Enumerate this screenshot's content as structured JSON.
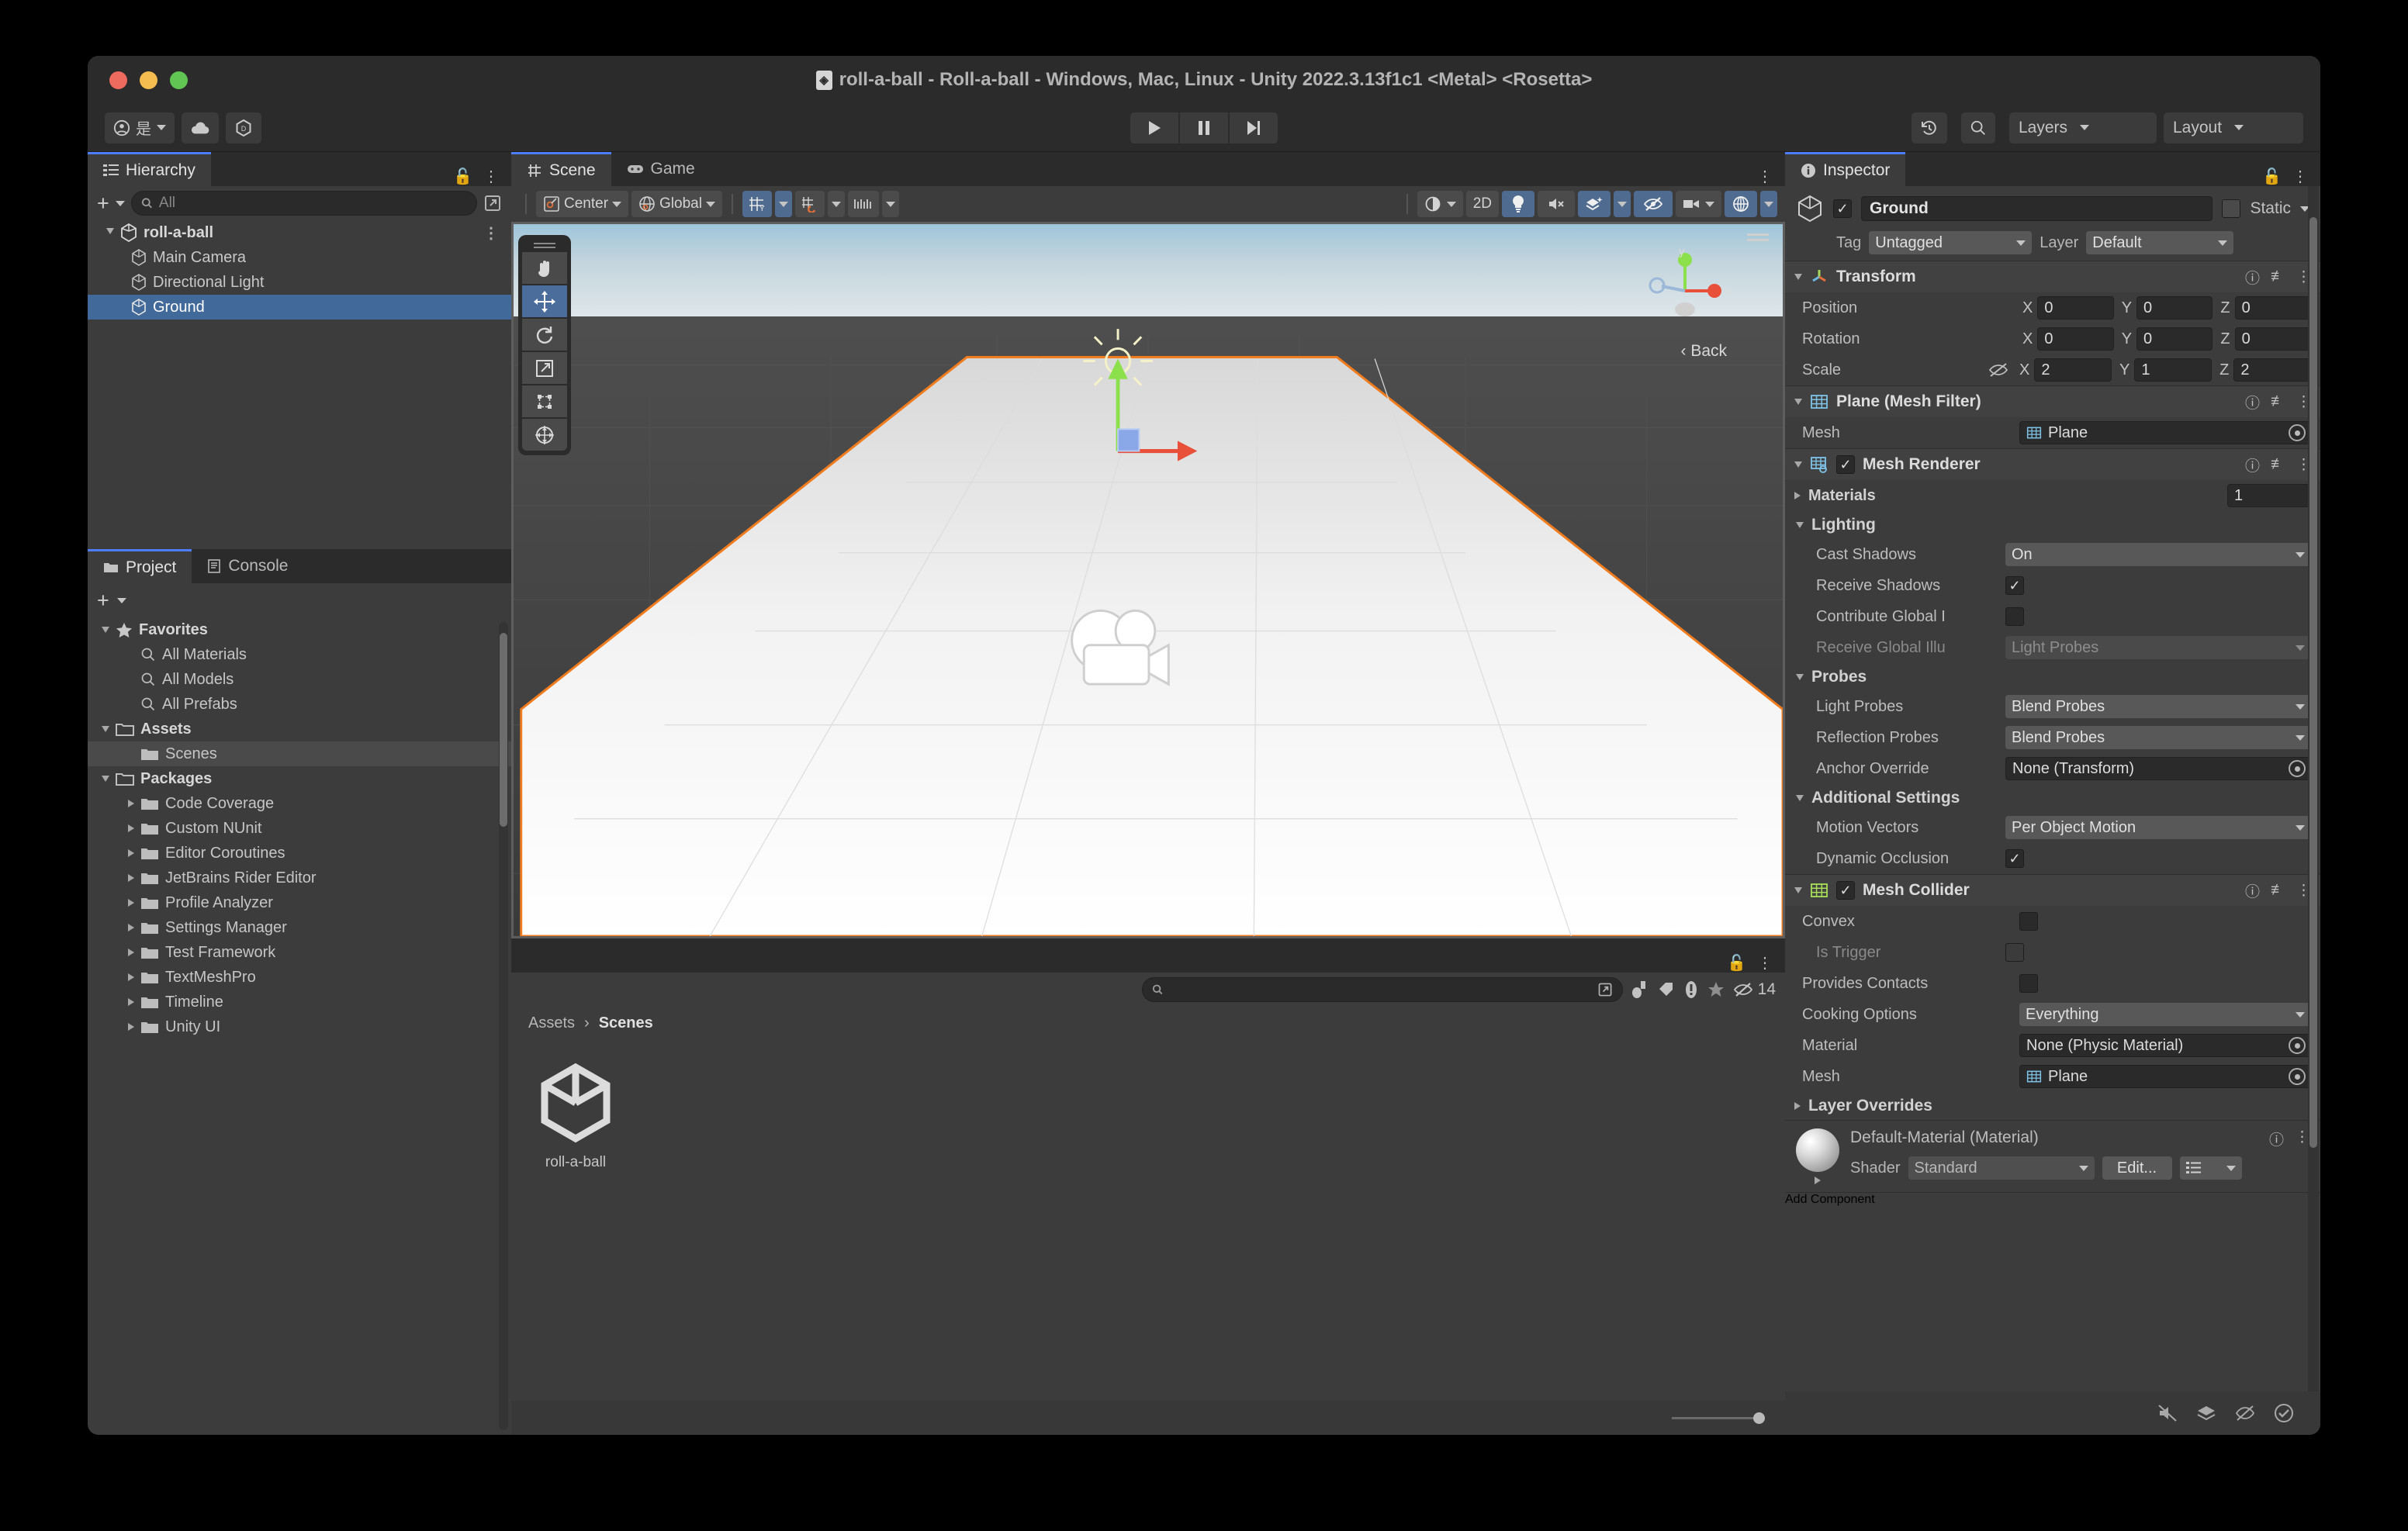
{
  "window": {
    "title": "roll-a-ball - Roll-a-ball - Windows, Mac, Linux - Unity 2022.3.13f1c1 <Metal> <Rosetta>"
  },
  "toolbar": {
    "account_label": "是",
    "cloud_icon": "cloud-icon",
    "services_icon": "unity-services-icon",
    "play_icon": "play-icon",
    "pause_icon": "pause-icon",
    "step_icon": "step-icon",
    "undo_history_icon": "undo-history-icon",
    "search_icon": "search-icon",
    "layers_label": "Layers",
    "layout_label": "Layout"
  },
  "hierarchy": {
    "tab_label": "Hierarchy",
    "search_placeholder": "All",
    "items": [
      {
        "label": "roll-a-ball",
        "depth": 0,
        "selected": false,
        "expanded": true
      },
      {
        "label": "Main Camera",
        "depth": 1,
        "selected": false
      },
      {
        "label": "Directional Light",
        "depth": 1,
        "selected": false
      },
      {
        "label": "Ground",
        "depth": 1,
        "selected": true
      }
    ]
  },
  "scene": {
    "tab_scene": "Scene",
    "tab_game": "Game",
    "pivot_mode": "Center",
    "pivot_rotation": "Global",
    "shading_mode": "shaded-icon",
    "view_2d": "2D",
    "lighting_icon": "lighting-icon",
    "audio_icon": "audio-mute-icon",
    "effects_icon": "effects-icon",
    "hidden_icon": "hidden-objects-icon",
    "camera_icon": "scene-camera-icon",
    "gizmos_icon": "gizmos-icon",
    "grid_icon": "grid-axis-icon",
    "snap_icon": "snap-increment-icon",
    "ruler_icon": "grid-size-icon",
    "orientation_back_label": "Back",
    "gizmo_axis_x": "x",
    "gizmo_axis_y": "y",
    "tools": [
      {
        "name": "hand-tool",
        "active": false
      },
      {
        "name": "move-tool",
        "active": true
      },
      {
        "name": "rotate-tool",
        "active": false
      },
      {
        "name": "scale-tool",
        "active": false
      },
      {
        "name": "rect-tool",
        "active": false
      },
      {
        "name": "transform-tool",
        "active": false
      }
    ]
  },
  "project": {
    "tab_project": "Project",
    "tab_console": "Console",
    "search_placeholder": "",
    "filter_count": "14",
    "breadcrumb": [
      "Assets",
      "Scenes"
    ],
    "tree": [
      {
        "label": "Favorites",
        "depth": 0,
        "icon": "star-icon",
        "expanded": true,
        "bold": true
      },
      {
        "label": "All Materials",
        "depth": 1,
        "icon": "search-icon"
      },
      {
        "label": "All Models",
        "depth": 1,
        "icon": "search-icon"
      },
      {
        "label": "All Prefabs",
        "depth": 1,
        "icon": "search-icon"
      },
      {
        "label": "Assets",
        "depth": 0,
        "icon": "folder-open-icon",
        "expanded": true,
        "bold": true
      },
      {
        "label": "Scenes",
        "depth": 1,
        "icon": "folder-icon",
        "selected": true
      },
      {
        "label": "Packages",
        "depth": 0,
        "icon": "folder-open-icon",
        "expanded": true,
        "bold": true
      },
      {
        "label": "Code Coverage",
        "depth": 1,
        "icon": "folder-icon",
        "collapsed": true
      },
      {
        "label": "Custom NUnit",
        "depth": 1,
        "icon": "folder-icon",
        "collapsed": true
      },
      {
        "label": "Editor Coroutines",
        "depth": 1,
        "icon": "folder-icon",
        "collapsed": true
      },
      {
        "label": "JetBrains Rider Editor",
        "depth": 1,
        "icon": "folder-icon",
        "collapsed": true
      },
      {
        "label": "Profile Analyzer",
        "depth": 1,
        "icon": "folder-icon",
        "collapsed": true
      },
      {
        "label": "Settings Manager",
        "depth": 1,
        "icon": "folder-icon",
        "collapsed": true
      },
      {
        "label": "Test Framework",
        "depth": 1,
        "icon": "folder-icon",
        "collapsed": true
      },
      {
        "label": "TextMeshPro",
        "depth": 1,
        "icon": "folder-icon",
        "collapsed": true
      },
      {
        "label": "Timeline",
        "depth": 1,
        "icon": "folder-icon",
        "collapsed": true
      },
      {
        "label": "Unity UI",
        "depth": 1,
        "icon": "folder-icon",
        "collapsed": true
      }
    ],
    "assets": [
      {
        "label": "roll-a-ball",
        "icon": "unity-scene-icon"
      }
    ]
  },
  "inspector": {
    "tab_label": "Inspector",
    "object_name": "Ground",
    "object_enabled": true,
    "static_label": "Static",
    "tag_label": "Tag",
    "tag_value": "Untagged",
    "layer_label": "Layer",
    "layer_value": "Default",
    "transform": {
      "title": "Transform",
      "position_label": "Position",
      "rotation_label": "Rotation",
      "scale_label": "Scale",
      "position": {
        "x": "0",
        "y": "0",
        "z": "0"
      },
      "rotation": {
        "x": "0",
        "y": "0",
        "z": "0"
      },
      "scale": {
        "x": "2",
        "y": "1",
        "z": "2"
      }
    },
    "mesh_filter": {
      "title": "Plane (Mesh Filter)",
      "mesh_label": "Mesh",
      "mesh_value": "Plane"
    },
    "mesh_renderer": {
      "title": "Mesh Renderer",
      "enabled": true,
      "materials_label": "Materials",
      "materials_count": "1",
      "lighting_label": "Lighting",
      "cast_shadows_label": "Cast Shadows",
      "cast_shadows_value": "On",
      "receive_shadows_label": "Receive Shadows",
      "receive_shadows_checked": true,
      "contribute_gi_label": "Contribute Global I",
      "contribute_gi_checked": false,
      "receive_gi_label": "Receive Global Illu",
      "receive_gi_value": "Light Probes",
      "probes_label": "Probes",
      "light_probes_label": "Light Probes",
      "light_probes_value": "Blend Probes",
      "reflection_probes_label": "Reflection Probes",
      "reflection_probes_value": "Blend Probes",
      "anchor_override_label": "Anchor Override",
      "anchor_override_value": "None (Transform)",
      "additional_settings_label": "Additional Settings",
      "motion_vectors_label": "Motion Vectors",
      "motion_vectors_value": "Per Object Motion",
      "dynamic_occlusion_label": "Dynamic Occlusion",
      "dynamic_occlusion_checked": true
    },
    "mesh_collider": {
      "title": "Mesh Collider",
      "enabled": true,
      "convex_label": "Convex",
      "convex_checked": false,
      "is_trigger_label": "Is Trigger",
      "is_trigger_checked": false,
      "provides_contacts_label": "Provides Contacts",
      "provides_contacts_checked": false,
      "cooking_options_label": "Cooking Options",
      "cooking_options_value": "Everything",
      "material_label": "Material",
      "material_value": "None (Physic Material)",
      "mesh_label": "Mesh",
      "mesh_value": "Plane",
      "layer_overrides_label": "Layer Overrides"
    },
    "material": {
      "title": "Default-Material (Material)",
      "shader_label": "Shader",
      "shader_value": "Standard",
      "edit_label": "Edit..."
    },
    "add_component_label": "Add Component"
  },
  "colors": {
    "accent_blue": "#4c7eff",
    "selection_blue": "#41699a",
    "tool_active": "#4a6d9c",
    "panel_bg": "#3c3c3c",
    "chrome_bg": "#2b2b2b",
    "selection_outline": "#f07c1e"
  }
}
